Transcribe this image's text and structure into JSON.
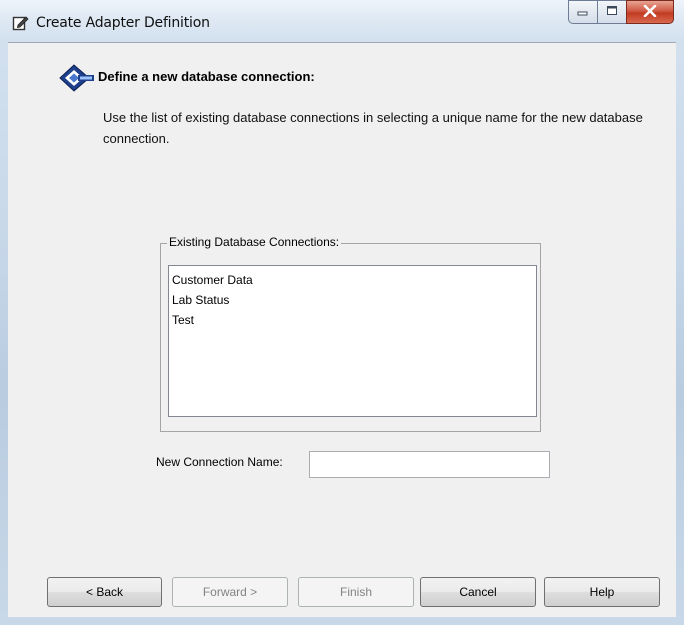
{
  "window": {
    "title": "Create Adapter Definition",
    "controls": {
      "minimize_icon": "minimize-icon",
      "maximize_icon": "maximize-icon",
      "close_icon": "close-icon"
    }
  },
  "header": {
    "icon": "database-wizard-icon",
    "title": "Define a new database connection:",
    "description": "Use the list of existing database connections in selecting a unique name for the new database connection."
  },
  "existing_connections": {
    "label": "Existing Database Connections:",
    "items": [
      "Customer Data",
      "Lab Status",
      "Test"
    ]
  },
  "new_connection": {
    "label": "New Connection Name:",
    "value": "",
    "placeholder": ""
  },
  "buttons": {
    "back": "< Back",
    "forward": "Forward >",
    "finish": "Finish",
    "cancel": "Cancel",
    "help": "Help"
  },
  "colors": {
    "client_background": "#f0f0f0",
    "close_button": "#c23a22",
    "frame": "#c9d9ea"
  }
}
